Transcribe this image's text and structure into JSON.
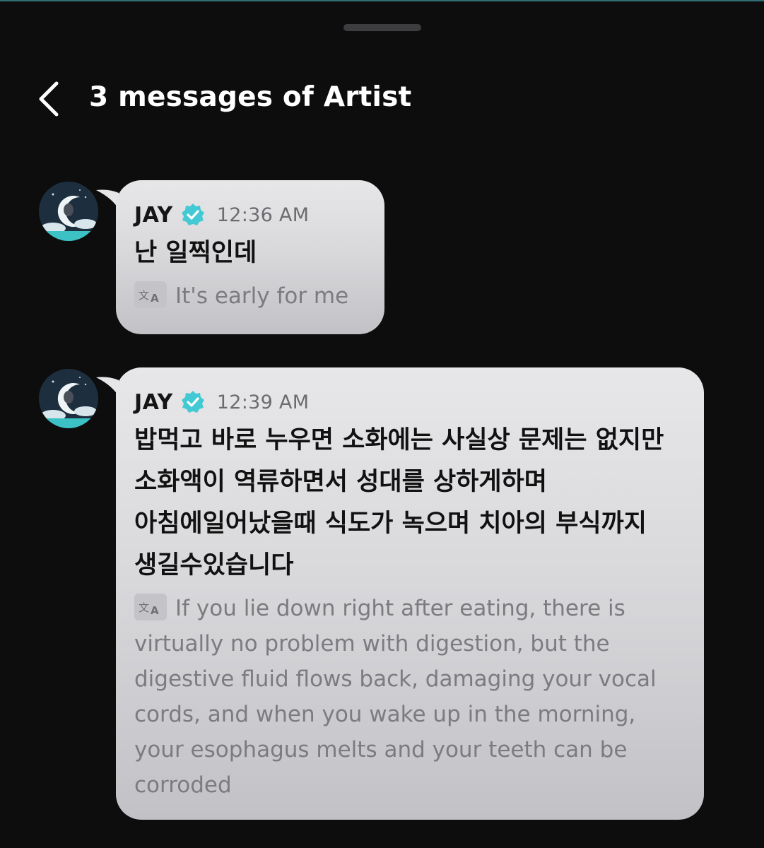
{
  "header": {
    "title": "3 messages of Artist"
  },
  "icons": {
    "back": "chevron-left-icon",
    "verified": "verified-badge-icon",
    "translate": "translate-icon",
    "avatar": "moon-avatar"
  },
  "colors": {
    "background": "#0d0d0e",
    "bubble": "#dcdcdf",
    "verified": "#43c9d3",
    "time": "#6c6c70",
    "translation": "#7b7b80"
  },
  "messages": [
    {
      "sender": "JAY",
      "time": "12:36 AM",
      "text": "난 일찍인데",
      "translation": "It's early for me"
    },
    {
      "sender": "JAY",
      "time": "12:39 AM",
      "text": "밥먹고 바로 누우면 소화에는 사실상 문제는 없지만 소화액이 역류하면서 성대를 상하게하며 아침에일어났을때 식도가 녹으며 치아의 부식까지 생길수있습니다",
      "translation": "If you lie down right after eating, there is virtually no problem with digestion, but the digestive fluid flows back, damaging your vocal cords, and when you wake up in the morning, your esophagus melts and your teeth can be corroded"
    }
  ]
}
